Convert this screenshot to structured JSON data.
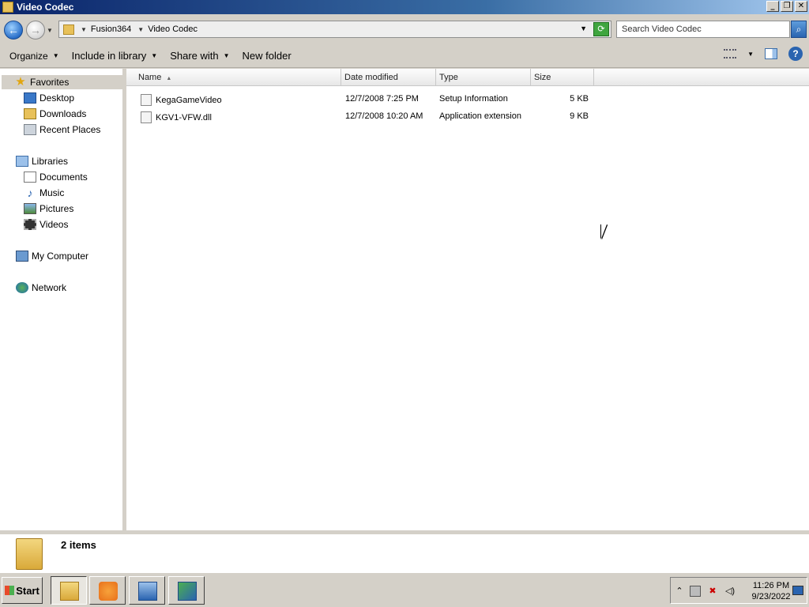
{
  "window": {
    "title": "Video Codec",
    "min": "_",
    "max": "❐",
    "close": "✕"
  },
  "address": {
    "crumbs": [
      "Fusion364",
      "Video Codec"
    ],
    "search_placeholder": "Search Video Codec"
  },
  "toolbar": {
    "organize": "Organize",
    "include": "Include in library",
    "share": "Share with",
    "newfolder": "New folder"
  },
  "nav": {
    "favorites": "Favorites",
    "desktop": "Desktop",
    "downloads": "Downloads",
    "recent": "Recent Places",
    "libraries": "Libraries",
    "documents": "Documents",
    "music": "Music",
    "pictures": "Pictures",
    "videos": "Videos",
    "computer": "My Computer",
    "network": "Network"
  },
  "columns": {
    "name": "Name",
    "date": "Date modified",
    "type": "Type",
    "size": "Size"
  },
  "files": [
    {
      "name": "KegaGameVideo",
      "date": "12/7/2008 7:25 PM",
      "type": "Setup Information",
      "size": "5 KB"
    },
    {
      "name": "KGV1-VFW.dll",
      "date": "12/7/2008 10:20 AM",
      "type": "Application extension",
      "size": "9 KB"
    }
  ],
  "status": {
    "count": "2 items"
  },
  "taskbar": {
    "start": "Start",
    "time": "11:26 PM",
    "date": "9/23/2022"
  },
  "colors": {
    "title_bar": "#0a246a",
    "selection": "#d4d0c8",
    "accent": "#2a64b0"
  },
  "icons": [
    "folder-icon",
    "back-icon",
    "forward-icon",
    "refresh-icon",
    "search-icon",
    "help-icon",
    "star-icon",
    "computer-icon",
    "network-icon"
  ]
}
